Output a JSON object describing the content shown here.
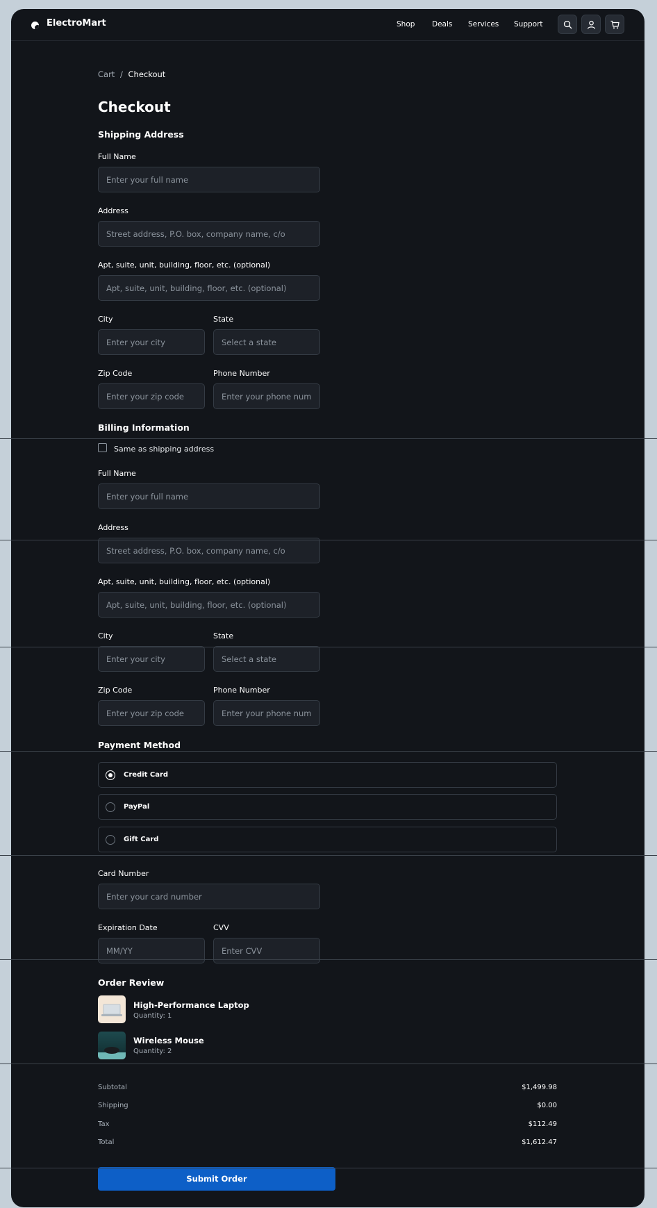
{
  "brand": "ElectroMart",
  "nav": {
    "links": [
      "Shop",
      "Deals",
      "Services",
      "Support"
    ]
  },
  "breadcrumb": {
    "parent": "Cart",
    "separator": "/",
    "current": "Checkout"
  },
  "page_title": "Checkout",
  "shipping": {
    "heading": "Shipping Address",
    "full_name_label": "Full Name",
    "full_name_placeholder": "Enter your full name",
    "address_label": "Address",
    "address_placeholder": "Street address, P.O. box, company name, c/o",
    "apt_label": "Apt, suite, unit, building, floor, etc. (optional)",
    "apt_placeholder": "Apt, suite, unit, building, floor, etc. (optional)",
    "city_label": "City",
    "city_placeholder": "Enter your city",
    "state_label": "State",
    "state_placeholder": "Select a state",
    "zip_label": "Zip Code",
    "zip_placeholder": "Enter your zip code",
    "phone_label": "Phone Number",
    "phone_placeholder": "Enter your phone number"
  },
  "billing": {
    "heading": "Billing Information",
    "same_as_shipping": "Same as shipping address",
    "full_name_label": "Full Name",
    "full_name_placeholder": "Enter your full name",
    "address_label": "Address",
    "address_placeholder": "Street address, P.O. box, company name, c/o",
    "apt_label": "Apt, suite, unit, building, floor, etc. (optional)",
    "apt_placeholder": "Apt, suite, unit, building, floor, etc. (optional)",
    "city_label": "City",
    "city_placeholder": "Enter your city",
    "state_label": "State",
    "state_placeholder": "Select a state",
    "zip_label": "Zip Code",
    "zip_placeholder": "Enter your zip code",
    "phone_label": "Phone Number",
    "phone_placeholder": "Enter your phone number"
  },
  "payment": {
    "heading": "Payment Method",
    "options": [
      "Credit Card",
      "PayPal",
      "Gift Card"
    ],
    "selected": "Credit Card",
    "card_number_label": "Card Number",
    "card_number_placeholder": "Enter your card number",
    "expiry_label": "Expiration Date",
    "expiry_placeholder": "MM/YY",
    "cvv_label": "CVV",
    "cvv_placeholder": "Enter CVV"
  },
  "order": {
    "heading": "Order Review",
    "items": [
      {
        "name": "High-Performance Laptop",
        "qty": "Quantity: 1"
      },
      {
        "name": "Wireless Mouse",
        "qty": "Quantity: 2"
      }
    ],
    "summary": [
      {
        "label": "Subtotal",
        "value": "$1,499.98"
      },
      {
        "label": "Shipping",
        "value": "$0.00"
      },
      {
        "label": "Tax",
        "value": "$112.49"
      },
      {
        "label": "Total",
        "value": "$1,612.47"
      }
    ],
    "submit_label": "Submit Order"
  },
  "colors": {
    "background": "#c5d0d9",
    "panel": "#12151a",
    "field": "#1d2128",
    "accent": "#0d5fc7"
  }
}
